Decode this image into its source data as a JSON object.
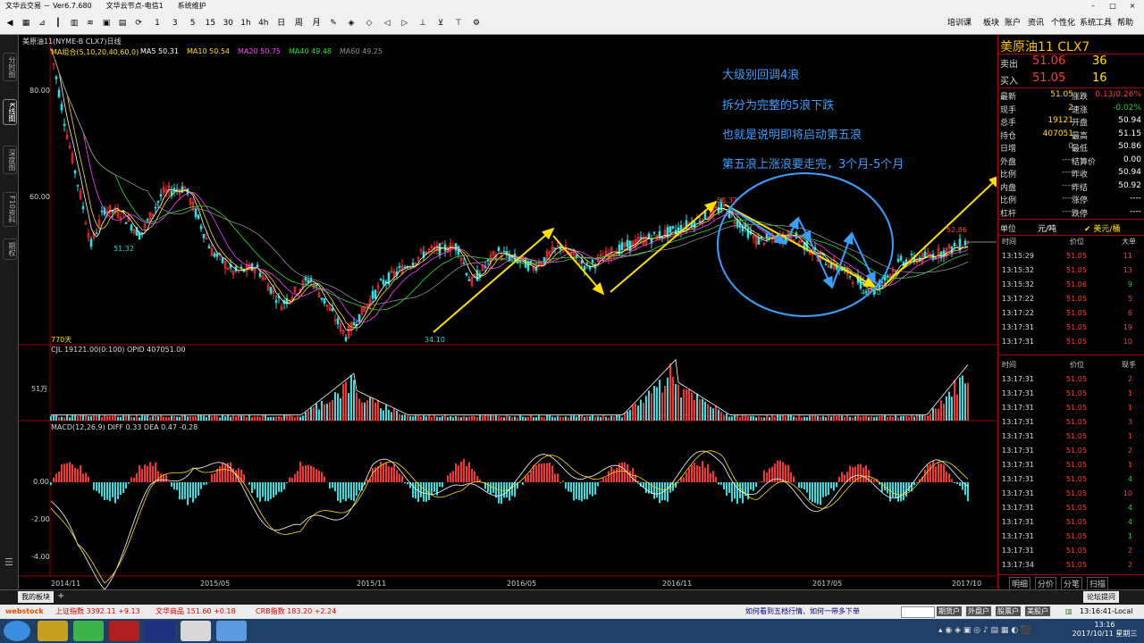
{
  "window": {
    "title": "文华云交易 － Ver6.7.680　　文华云节点-电信1　　系统维护"
  },
  "toolbar": {
    "periods": [
      "1",
      "3",
      "5",
      "15",
      "30",
      "1h",
      "4h",
      "日",
      "周",
      "月"
    ],
    "right_menu": [
      "培训课",
      "板块",
      "账户",
      "资讯",
      "个性化",
      "系统工具",
      "帮助"
    ]
  },
  "left_tabs": [
    "分时图",
    "K线图",
    "深度图",
    "F10资料",
    "期权"
  ],
  "chart": {
    "title": "美原油11(NYME-B CLX7)日线",
    "ma_legend": [
      {
        "text": "MA组合(5,10,20,40,60,0)",
        "color": "#ffe000"
      },
      {
        "text": "MA5 50.31",
        "color": "#ffffff"
      },
      {
        "text": "MA10 50.54",
        "color": "#ffe000"
      },
      {
        "text": "MA20 50.75",
        "color": "#ff40ff"
      },
      {
        "text": "MA40 49.48",
        "color": "#30e030"
      },
      {
        "text": "MA60 49.25",
        "color": "#909090"
      }
    ],
    "y_ticks": [
      "80.00",
      "60.00"
    ],
    "price_labels": [
      "51.32",
      "34.10",
      "58.37",
      "42.50",
      "52.86"
    ],
    "days_label": "770天",
    "vol_legend": "CJL  19121.00(0:100)   OPID  407051.00",
    "vol_tick": "51万",
    "macd_legend": "MACD(12,26,9)  DIFF  0.33   DEA  0.47     -0.28",
    "macd_ticks": [
      "0.00",
      "-2.00",
      "-4.00"
    ],
    "dates": [
      "2014/11",
      "2015/05",
      "2015/11",
      "2016/05",
      "2016/11",
      "2017/05",
      "2017/10"
    ]
  },
  "chart_data": {
    "type": "line",
    "title": "美原油11(NYME-B CLX7)日线",
    "xlabel": "",
    "ylabel": "",
    "x": [
      "2014/11",
      "2015/05",
      "2015/11",
      "2016/05",
      "2016/11",
      "2017/05",
      "2017/10"
    ],
    "series": [
      {
        "name": "",
        "values": [
          88,
          60,
          34.1,
          58.37,
          42.5,
          52.86
        ]
      }
    ],
    "ylim": [
      30,
      90
    ]
  },
  "annotations": [
    "大级别回调4浪",
    "拆分为完整的5浪下跌",
    "也就是说明即将启动第五浪",
    "第五浪上涨浪要走完，3个月-5个月"
  ],
  "quote": {
    "symbol": "美原油11  CLX7",
    "ask": {
      "label": "卖出",
      "price": "51.06",
      "vol": "36"
    },
    "bid": {
      "label": "买入",
      "price": "51.05",
      "vol": "16"
    },
    "stats_left": [
      {
        "k": "最新",
        "v": "51.05"
      },
      {
        "k": "现手",
        "v": "2"
      },
      {
        "k": "总手",
        "v": "19121"
      },
      {
        "k": "持仓",
        "v": "407051"
      },
      {
        "k": "日增",
        "v": "0"
      },
      {
        "k": "外盘",
        "v": "----"
      },
      {
        "k": "比例",
        "v": "----"
      },
      {
        "k": "内盘",
        "v": "----"
      },
      {
        "k": "比例",
        "v": "----"
      },
      {
        "k": "杠杆",
        "v": "----"
      }
    ],
    "stats_right": [
      {
        "k": "涨跌",
        "v": "0.13/0.26%"
      },
      {
        "k": "速涨",
        "v": "-0.02%"
      },
      {
        "k": "开盘",
        "v": "50.94"
      },
      {
        "k": "最高",
        "v": "51.15"
      },
      {
        "k": "最低",
        "v": "50.86"
      },
      {
        "k": "结算价",
        "v": "0.00"
      },
      {
        "k": "昨收",
        "v": "50.94"
      },
      {
        "k": "昨结",
        "v": "50.92"
      },
      {
        "k": "涨停",
        "v": "----"
      },
      {
        "k": "跌停",
        "v": "----"
      }
    ],
    "unit_label": "单位",
    "unit_value": "元/吨",
    "currency": "美元/桶",
    "tl1_header": [
      "时间",
      "价位",
      "大单"
    ],
    "tl1": [
      [
        "13:15:29",
        "51.05",
        "11"
      ],
      [
        "13:15:32",
        "51.05",
        "13"
      ],
      [
        "13:15:32",
        "51.06",
        "9"
      ],
      [
        "13:17:22",
        "51.05",
        "5"
      ],
      [
        "13:17:22",
        "51.05",
        "6"
      ],
      [
        "13:17:31",
        "51.05",
        "19"
      ],
      [
        "13:17:31",
        "51.05",
        "10"
      ]
    ],
    "tl2_header": [
      "时间",
      "价位",
      "现手"
    ],
    "tl2": [
      [
        "13:17:31",
        "51.05",
        "2"
      ],
      [
        "13:17:31",
        "51.05",
        "1"
      ],
      [
        "13:17:31",
        "51.05",
        "1"
      ],
      [
        "13:17:31",
        "51.05",
        "3"
      ],
      [
        "13:17:31",
        "51.05",
        "1"
      ],
      [
        "13:17:31",
        "51.05",
        "2"
      ],
      [
        "13:17:31",
        "51.05",
        "1"
      ],
      [
        "13:17:31",
        "51.05",
        "4"
      ],
      [
        "13:17:31",
        "51.05",
        "10"
      ],
      [
        "13:17:31",
        "51.05",
        "4"
      ],
      [
        "13:17:31",
        "51.05",
        "4"
      ],
      [
        "13:17:31",
        "51.05",
        "1"
      ],
      [
        "13:17:31",
        "51.05",
        "2"
      ],
      [
        "13:17:34",
        "51.05",
        "2"
      ]
    ],
    "bottom_tabs": [
      "明细",
      "分价",
      "分笔",
      "扫描"
    ]
  },
  "bottom": {
    "tab": "我的板块",
    "plus": "+"
  },
  "status": {
    "brand": "webstock",
    "idx1": "上证指数  3392.11  +9.13",
    "idx2": "文华商品  151.60  +0.18",
    "idx3": "CRB指数  183.20  +2.24",
    "hint": "如何看到五档行情、如何一带多下单",
    "accounts": [
      "期货户",
      "外盘户",
      "股票户",
      "美股户"
    ],
    "clock": "13:16:41-Local",
    "tray_time": "13:16",
    "tray_date": "2017/10/11 星期三",
    "forum": "论坛提问"
  }
}
